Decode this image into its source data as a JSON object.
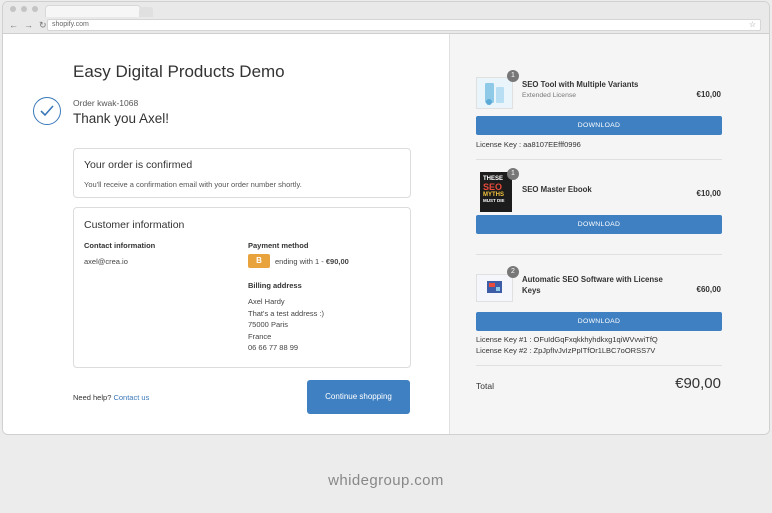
{
  "browser": {
    "url": "shopify.com"
  },
  "shop": {
    "title": "Easy Digital Products Demo"
  },
  "order": {
    "number": "Order kwak-1068",
    "thanks": "Thank you Axel!"
  },
  "confirmed": {
    "heading": "Your order is confirmed",
    "text": "You'll receive a confirmation email with your order number shortly."
  },
  "customer": {
    "heading": "Customer information",
    "contact_label": "Contact information",
    "email": "axel@crea.io",
    "payment_label": "Payment method",
    "payment_icon": "B",
    "payment_text": "ending with 1 - ",
    "payment_amount": "€90,00",
    "billing_label": "Billing address",
    "billing_lines": [
      "Axel Hardy",
      "That's a test address :)",
      "75000 Paris",
      "France",
      "06 66 77 88 99"
    ]
  },
  "help": {
    "text": "Need help?",
    "link": "Contact us"
  },
  "continue_label": "Continue shopping",
  "items": [
    {
      "qty": "1",
      "name": "SEO Tool with Multiple Variants",
      "variant": "Extended License",
      "price": "€10,00",
      "download": "DOWNLOAD",
      "keys": [
        "License Key : aa8107EEfff0996"
      ]
    },
    {
      "qty": "1",
      "name": "SEO Master Ebook",
      "variant": "",
      "price": "€10,00",
      "download": "DOWNLOAD",
      "keys": [],
      "book_lines": [
        "THESE",
        "SEO",
        "MYTHS",
        "MUST DIE"
      ]
    },
    {
      "qty": "2",
      "name_lines": [
        "Automatic SEO Software with License",
        "Keys"
      ],
      "price": "€60,00",
      "download": "DOWNLOAD",
      "keys": [
        "License Key #1 : OFuIdGqFxqkkhyhdkxg1qiWVvwiTfQ",
        "License Key #2 : ZpJpfIvJvIzPpITfOr1LBC7oORSS7V"
      ]
    }
  ],
  "total": {
    "label": "Total",
    "value": "€90,00"
  },
  "footer": "whidegroup.com",
  "colors": {
    "accent": "#3f80c2",
    "bitcoin": "#e8a33d",
    "background": "#ececec"
  }
}
